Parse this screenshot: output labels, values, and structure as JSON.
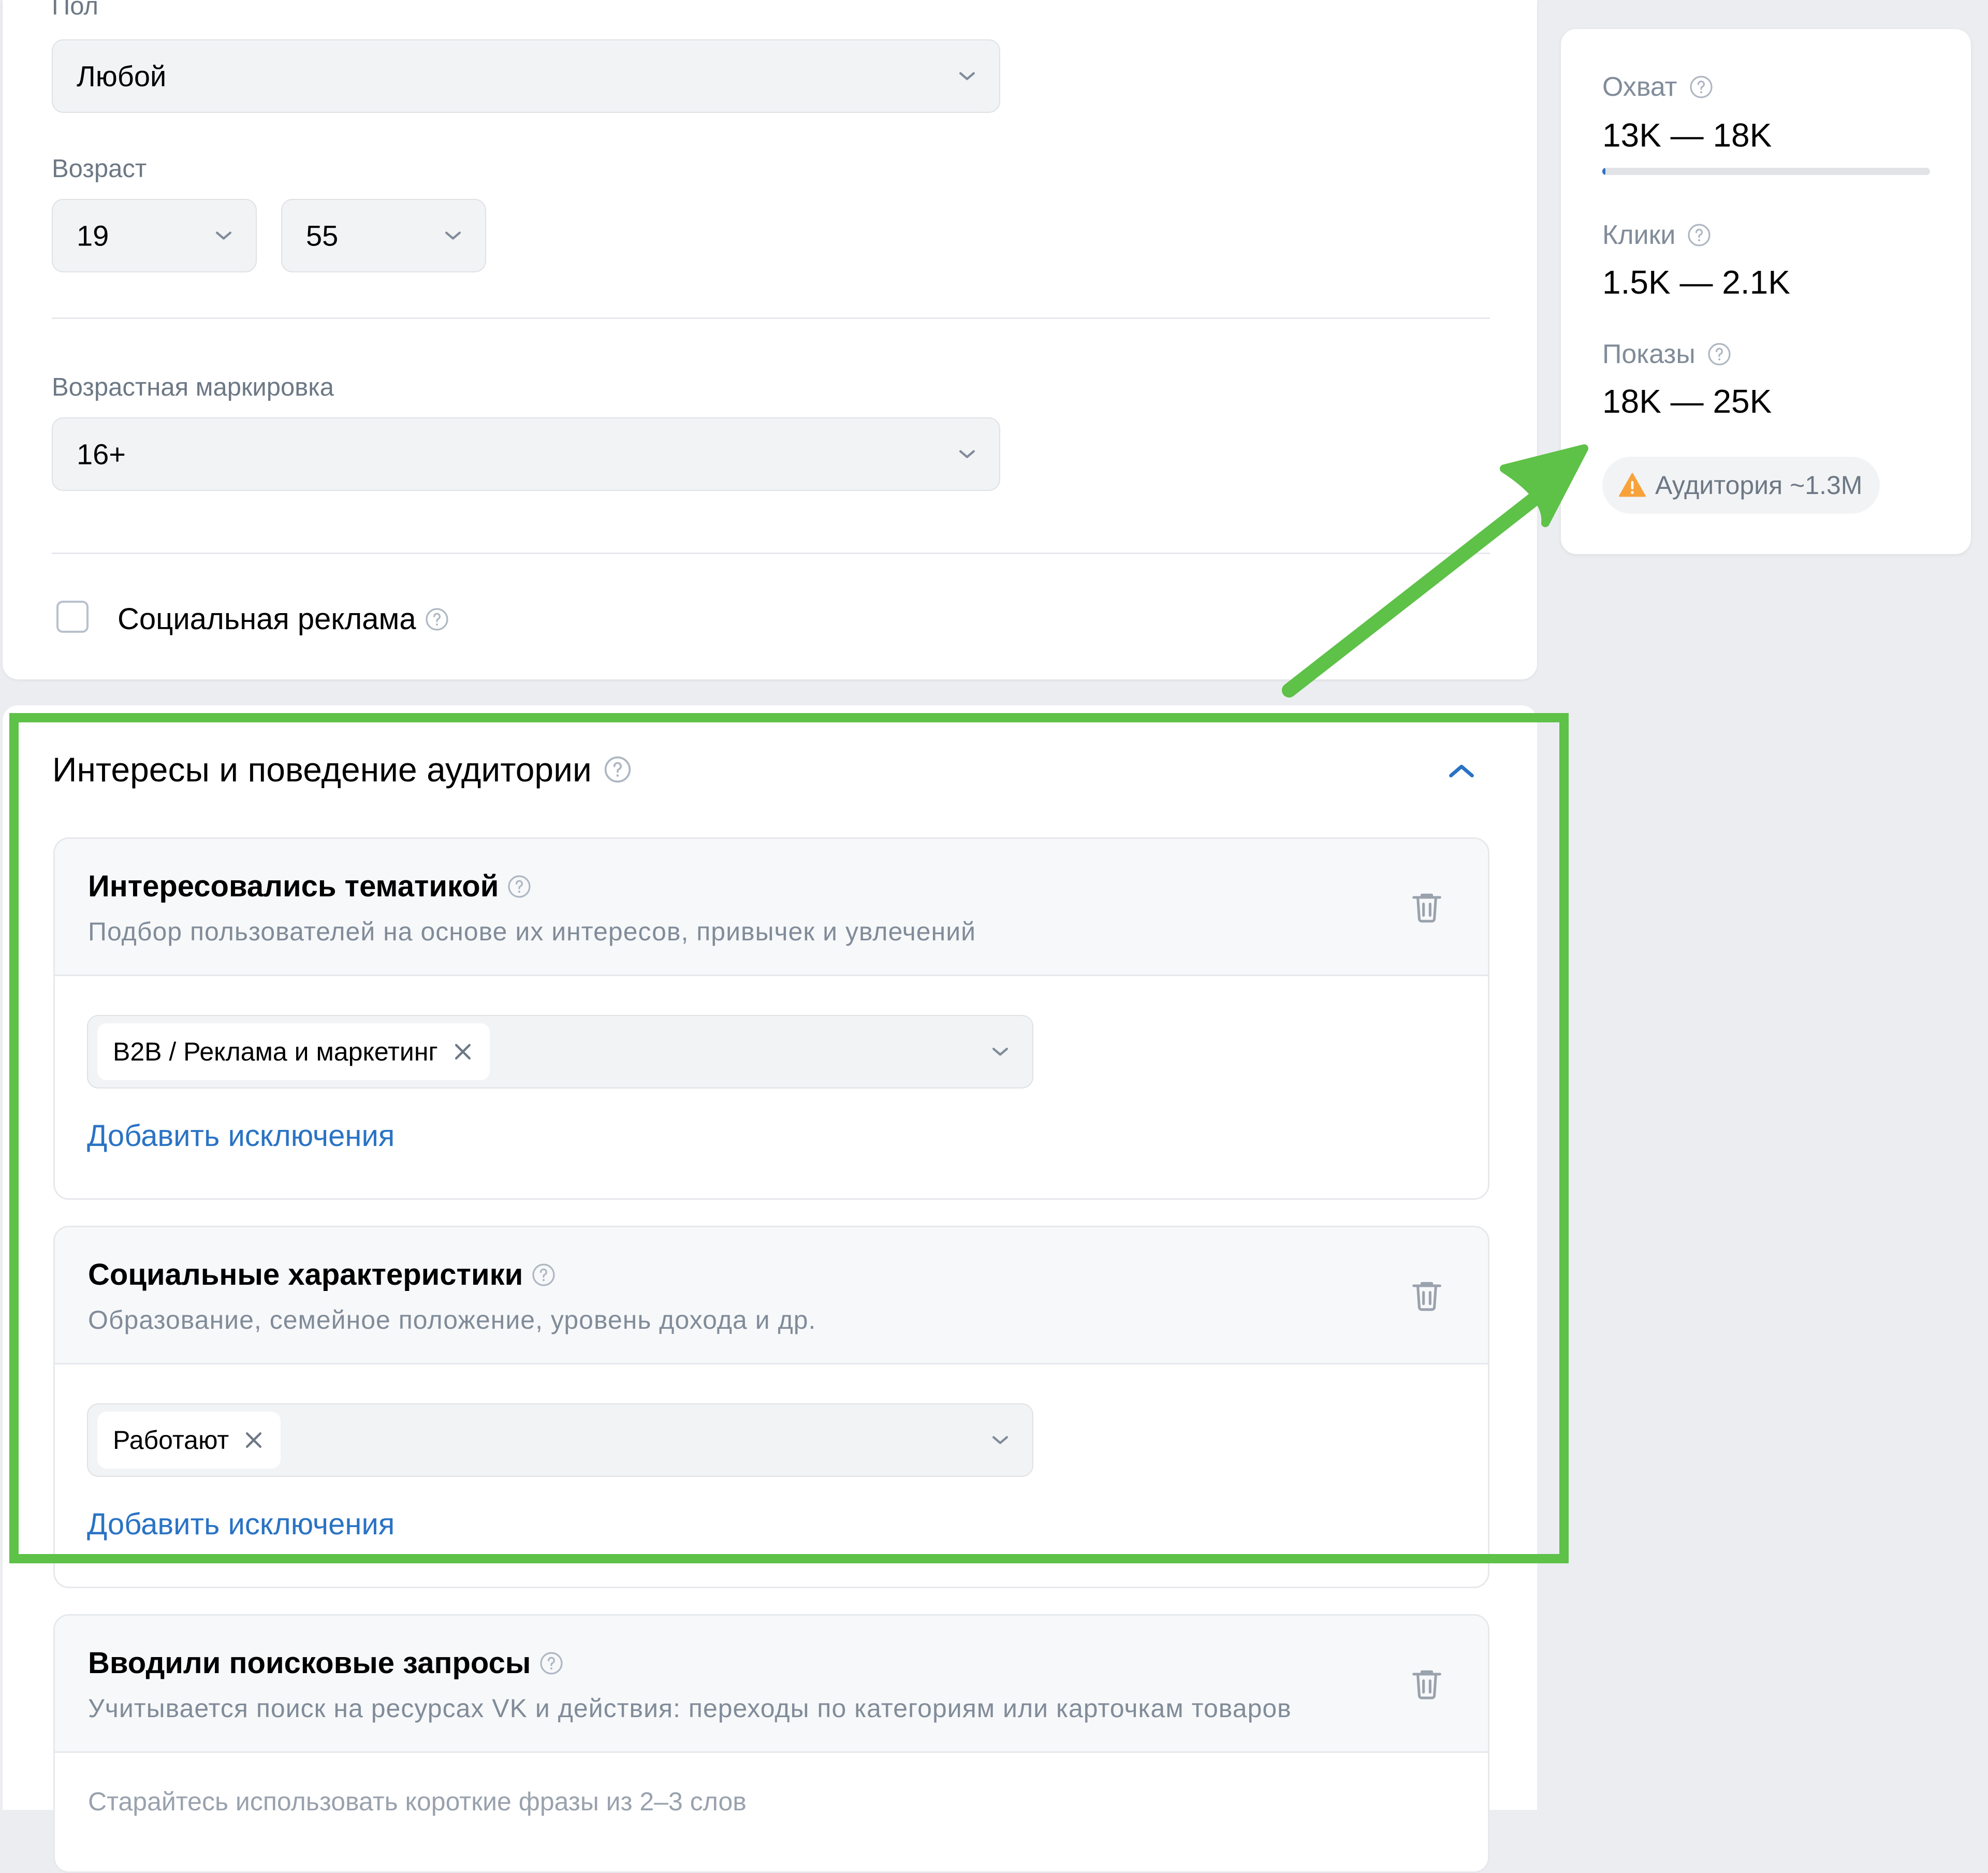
{
  "form": {
    "gender_label": "Пол",
    "gender_value": "Любой",
    "age_label": "Возраст",
    "age_from": "19",
    "age_to": "55",
    "age_marking_label": "Возрастная маркировка",
    "age_marking_value": "16+",
    "social_ad_label": "Социальная реклама",
    "social_ad_checked": false
  },
  "interests": {
    "title": "Интересы и поведение аудитории",
    "blocks": [
      {
        "title": "Интересовались тематикой",
        "description": "Подбор пользователей на основе их интересов, привычек и увлечений",
        "chips": [
          "B2B / Реклама и маркетинг"
        ],
        "add_exclusions": "Добавить исключения"
      },
      {
        "title": "Социальные характеристики",
        "description": "Образование, семейное положение, уровень дохода и др.",
        "chips": [
          "Работают"
        ],
        "add_exclusions": "Добавить исключения"
      },
      {
        "title": "Вводили поисковые запросы",
        "description": "Учитывается поиск на ресурсах VK и действия: переходы по категориям или карточкам товаров",
        "hint_partial": "Старайтесь использовать короткие фразы из 2–3 слов"
      }
    ]
  },
  "stats": {
    "reach_label": "Охват",
    "reach_value": "13K — 18K",
    "reach_progress": 0.01,
    "clicks_label": "Клики",
    "clicks_value": "1.5K — 2.1K",
    "impressions_label": "Показы",
    "impressions_value": "18K — 25K",
    "audience_badge": "Аудитория ~1.3M"
  },
  "icons": {
    "chevron": "chevron-down-icon",
    "help": "question-circle-icon",
    "trash": "trash-icon",
    "warning": "warning-triangle-icon",
    "remove": "close-icon",
    "collapse": "chevron-up-icon"
  },
  "colors": {
    "accent": "#2a73c4",
    "highlight_green": "#5ec148",
    "warning": "#f7a23b",
    "page_bg": "#ebedf0"
  }
}
